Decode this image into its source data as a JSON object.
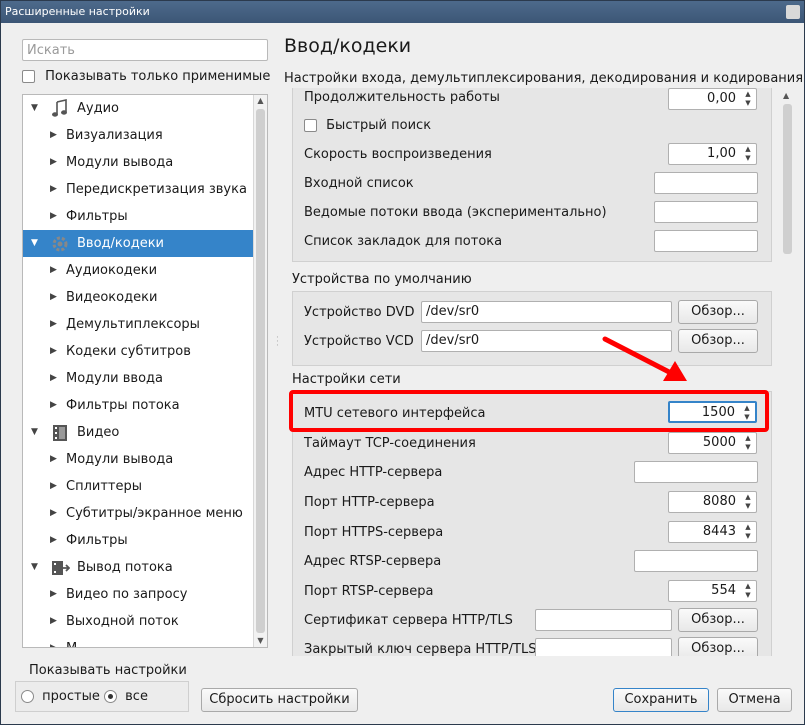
{
  "window": {
    "title": "Расширенные настройки"
  },
  "search": {
    "placeholder": "Искать"
  },
  "only_applied_label": "Показывать только применимые",
  "tree": [
    {
      "type": "cat",
      "label": "Аудио",
      "icon": "music-note-icon",
      "expanded": true
    },
    {
      "type": "sub",
      "label": "Визуализация"
    },
    {
      "type": "sub",
      "label": "Модули вывода"
    },
    {
      "type": "sub",
      "label": "Передискретизация звука"
    },
    {
      "type": "sub",
      "label": "Фильтры"
    },
    {
      "type": "cat",
      "label": "Ввод/кодеки",
      "icon": "gear-icon",
      "expanded": true,
      "selected": true
    },
    {
      "type": "sub",
      "label": "Аудиокодеки"
    },
    {
      "type": "sub",
      "label": "Видеокодеки"
    },
    {
      "type": "sub",
      "label": "Демультиплексоры"
    },
    {
      "type": "sub",
      "label": "Кодеки субтитров"
    },
    {
      "type": "sub",
      "label": "Модули ввода"
    },
    {
      "type": "sub",
      "label": "Фильтры потока"
    },
    {
      "type": "cat",
      "label": "Видео",
      "icon": "film-icon",
      "expanded": true
    },
    {
      "type": "sub",
      "label": "Модули вывода"
    },
    {
      "type": "sub",
      "label": "Сплиттеры"
    },
    {
      "type": "sub",
      "label": "Субтитры/экранное меню"
    },
    {
      "type": "sub",
      "label": "Фильтры"
    },
    {
      "type": "cat",
      "label": "Вывод потока",
      "icon": "stream-output-icon",
      "expanded": true
    },
    {
      "type": "sub",
      "label": "Видео по запросу"
    },
    {
      "type": "sub",
      "label": "Выходной поток"
    },
    {
      "type": "sub",
      "label": "М..."
    }
  ],
  "main": {
    "title": "Ввод/кодеки",
    "subtitle": "Настройки входа, демультиплексирования, декодирования и кодирования",
    "top": {
      "duration_label": "Продолжительность работы",
      "duration_value": "0,00",
      "fast_seek_label": "Быстрый поиск",
      "speed_label": "Скорость воспроизведения",
      "speed_value": "1,00",
      "input_list_label": "Входной список",
      "slave_label": "Ведомые потоки ввода (экспериментально)",
      "bookmarks_label": "Список закладок для потока"
    },
    "devices": {
      "group_label": "Устройства по умолчанию",
      "dvd_label": "Устройство DVD",
      "dvd_value": "/dev/sr0",
      "vcd_label": "Устройство VCD",
      "vcd_value": "/dev/sr0",
      "browse_label": "Обзор..."
    },
    "network": {
      "group_label": "Настройки сети",
      "mtu_label": "MTU сетевого интерфейса",
      "mtu_value": "1500",
      "tcp_timeout_label": "Таймаут TCP-соединения",
      "tcp_timeout_value": "5000",
      "http_addr_label": "Адрес HTTP-сервера",
      "http_port_label": "Порт HTTP-сервера",
      "http_port_value": "8080",
      "https_port_label": "Порт HTTPS-сервера",
      "https_port_value": "8443",
      "rtsp_addr_label": "Адрес RTSP-сервера",
      "rtsp_port_label": "Порт RTSP-сервера",
      "rtsp_port_value": "554",
      "cert_label": "Сертификат сервера HTTP/TLS",
      "key_label": "Закрытый ключ сервера HTTP/TLS",
      "browse_label": "Обзор..."
    }
  },
  "bottom": {
    "show_settings_label": "Показывать настройки",
    "simple_label": "простые",
    "all_label": "все",
    "reset_label": "Сбросить настройки",
    "save_label": "Сохранить",
    "cancel_label": "Отмена"
  },
  "annotation": {
    "highlight_color": "#ff0000",
    "arrow_color": "#ff0000"
  },
  "colors": {
    "selection": "#3584c9",
    "titlebar": "#3c5676"
  }
}
